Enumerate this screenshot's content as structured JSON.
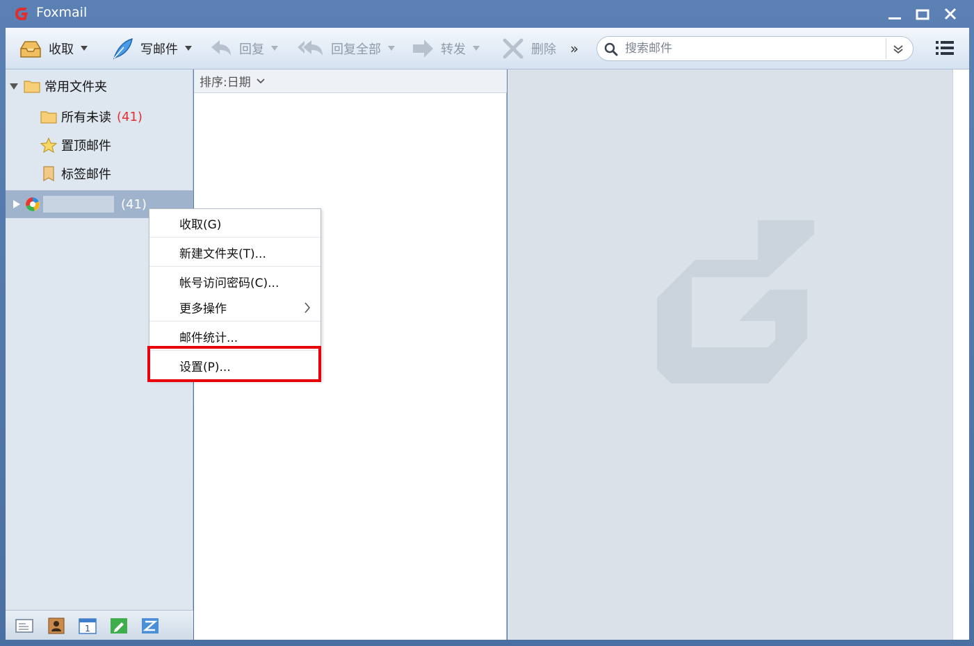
{
  "window": {
    "title": "Foxmail",
    "brand_color": "#d92a2a"
  },
  "toolbar": {
    "receive": "收取",
    "compose": "写邮件",
    "reply": "回复",
    "reply_all": "回复全部",
    "forward": "转发",
    "delete": "删除",
    "more": "»"
  },
  "search": {
    "placeholder": "搜索邮件"
  },
  "sidebar": {
    "group_label": "常用文件夹",
    "items": [
      {
        "label": "所有未读",
        "count": "(41)",
        "icon": "folder-icon"
      },
      {
        "label": "置顶邮件",
        "count": "",
        "icon": "star-icon"
      },
      {
        "label": "标签邮件",
        "count": "",
        "icon": "tag-icon"
      }
    ],
    "account": {
      "count": "(41)",
      "icon": "account-icon"
    }
  },
  "maillist": {
    "sort_label": "排序:日期"
  },
  "context_menu": {
    "items": [
      {
        "label": "收取(G)"
      },
      {
        "label": "新建文件夹(T)..."
      },
      {
        "label": "帐号访问密码(C)..."
      },
      {
        "label": "更多操作",
        "submenu": true
      },
      {
        "label": "邮件统计..."
      },
      {
        "label": "设置(P)...",
        "highlighted": true
      }
    ],
    "highlight_color": "#e8000b"
  }
}
